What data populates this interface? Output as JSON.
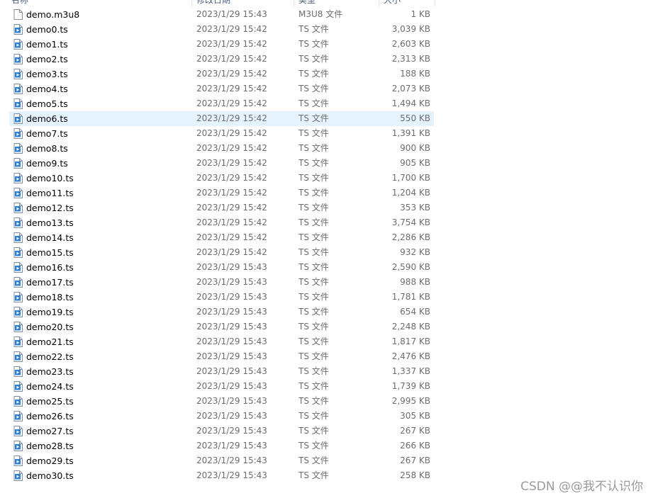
{
  "header": {
    "name": "名称",
    "date": "修改日期",
    "type": "类型",
    "size": "大小"
  },
  "files": [
    {
      "name": "demo.m3u8",
      "date": "2023/1/29 15:43",
      "type": "M3U8 文件",
      "size": "1 KB",
      "icon": "blank-file-icon"
    },
    {
      "name": "demo0.ts",
      "date": "2023/1/29 15:42",
      "type": "TS 文件",
      "size": "3,039 KB",
      "icon": "video-file-icon"
    },
    {
      "name": "demo1.ts",
      "date": "2023/1/29 15:42",
      "type": "TS 文件",
      "size": "2,603 KB",
      "icon": "video-file-icon"
    },
    {
      "name": "demo2.ts",
      "date": "2023/1/29 15:42",
      "type": "TS 文件",
      "size": "2,313 KB",
      "icon": "video-file-icon"
    },
    {
      "name": "demo3.ts",
      "date": "2023/1/29 15:42",
      "type": "TS 文件",
      "size": "188 KB",
      "icon": "video-file-icon"
    },
    {
      "name": "demo4.ts",
      "date": "2023/1/29 15:42",
      "type": "TS 文件",
      "size": "2,073 KB",
      "icon": "video-file-icon"
    },
    {
      "name": "demo5.ts",
      "date": "2023/1/29 15:42",
      "type": "TS 文件",
      "size": "1,494 KB",
      "icon": "video-file-icon"
    },
    {
      "name": "demo6.ts",
      "date": "2023/1/29 15:42",
      "type": "TS 文件",
      "size": "550 KB",
      "icon": "video-file-icon",
      "selected": true
    },
    {
      "name": "demo7.ts",
      "date": "2023/1/29 15:42",
      "type": "TS 文件",
      "size": "1,391 KB",
      "icon": "video-file-icon"
    },
    {
      "name": "demo8.ts",
      "date": "2023/1/29 15:42",
      "type": "TS 文件",
      "size": "900 KB",
      "icon": "video-file-icon"
    },
    {
      "name": "demo9.ts",
      "date": "2023/1/29 15:42",
      "type": "TS 文件",
      "size": "905 KB",
      "icon": "video-file-icon"
    },
    {
      "name": "demo10.ts",
      "date": "2023/1/29 15:42",
      "type": "TS 文件",
      "size": "1,700 KB",
      "icon": "video-file-icon"
    },
    {
      "name": "demo11.ts",
      "date": "2023/1/29 15:42",
      "type": "TS 文件",
      "size": "1,204 KB",
      "icon": "video-file-icon"
    },
    {
      "name": "demo12.ts",
      "date": "2023/1/29 15:42",
      "type": "TS 文件",
      "size": "353 KB",
      "icon": "video-file-icon"
    },
    {
      "name": "demo13.ts",
      "date": "2023/1/29 15:42",
      "type": "TS 文件",
      "size": "3,754 KB",
      "icon": "video-file-icon"
    },
    {
      "name": "demo14.ts",
      "date": "2023/1/29 15:42",
      "type": "TS 文件",
      "size": "2,286 KB",
      "icon": "video-file-icon"
    },
    {
      "name": "demo15.ts",
      "date": "2023/1/29 15:42",
      "type": "TS 文件",
      "size": "932 KB",
      "icon": "video-file-icon"
    },
    {
      "name": "demo16.ts",
      "date": "2023/1/29 15:43",
      "type": "TS 文件",
      "size": "2,590 KB",
      "icon": "video-file-icon"
    },
    {
      "name": "demo17.ts",
      "date": "2023/1/29 15:43",
      "type": "TS 文件",
      "size": "988 KB",
      "icon": "video-file-icon"
    },
    {
      "name": "demo18.ts",
      "date": "2023/1/29 15:43",
      "type": "TS 文件",
      "size": "1,781 KB",
      "icon": "video-file-icon"
    },
    {
      "name": "demo19.ts",
      "date": "2023/1/29 15:43",
      "type": "TS 文件",
      "size": "654 KB",
      "icon": "video-file-icon"
    },
    {
      "name": "demo20.ts",
      "date": "2023/1/29 15:43",
      "type": "TS 文件",
      "size": "2,248 KB",
      "icon": "video-file-icon"
    },
    {
      "name": "demo21.ts",
      "date": "2023/1/29 15:43",
      "type": "TS 文件",
      "size": "1,817 KB",
      "icon": "video-file-icon"
    },
    {
      "name": "demo22.ts",
      "date": "2023/1/29 15:43",
      "type": "TS 文件",
      "size": "2,476 KB",
      "icon": "video-file-icon"
    },
    {
      "name": "demo23.ts",
      "date": "2023/1/29 15:43",
      "type": "TS 文件",
      "size": "1,337 KB",
      "icon": "video-file-icon"
    },
    {
      "name": "demo24.ts",
      "date": "2023/1/29 15:43",
      "type": "TS 文件",
      "size": "1,739 KB",
      "icon": "video-file-icon"
    },
    {
      "name": "demo25.ts",
      "date": "2023/1/29 15:43",
      "type": "TS 文件",
      "size": "2,995 KB",
      "icon": "video-file-icon"
    },
    {
      "name": "demo26.ts",
      "date": "2023/1/29 15:43",
      "type": "TS 文件",
      "size": "305 KB",
      "icon": "video-file-icon"
    },
    {
      "name": "demo27.ts",
      "date": "2023/1/29 15:43",
      "type": "TS 文件",
      "size": "267 KB",
      "icon": "video-file-icon"
    },
    {
      "name": "demo28.ts",
      "date": "2023/1/29 15:43",
      "type": "TS 文件",
      "size": "266 KB",
      "icon": "video-file-icon"
    },
    {
      "name": "demo29.ts",
      "date": "2023/1/29 15:43",
      "type": "TS 文件",
      "size": "267 KB",
      "icon": "video-file-icon"
    },
    {
      "name": "demo30.ts",
      "date": "2023/1/29 15:43",
      "type": "TS 文件",
      "size": "258 KB",
      "icon": "video-file-icon"
    }
  ],
  "watermark": "CSDN @@我不认识你",
  "colors": {
    "selection": "#e5f3ff",
    "header_text": "#4c607a",
    "secondary_text": "#6d6d6d",
    "icon_blue": "#2f7fd1"
  }
}
